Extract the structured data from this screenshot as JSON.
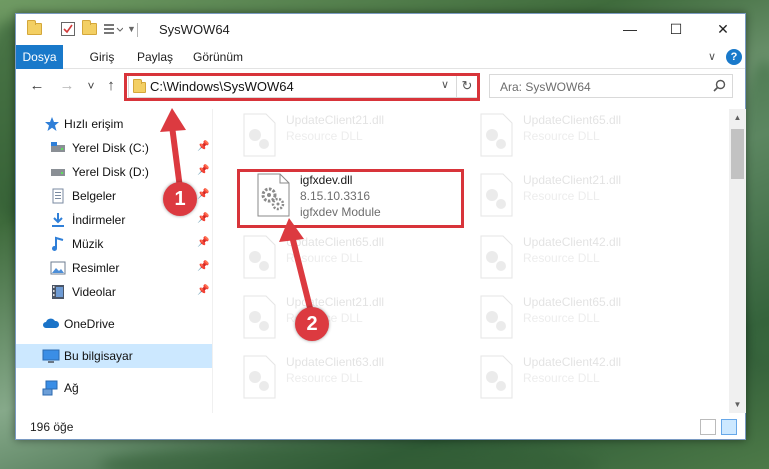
{
  "window": {
    "title": "SysWOW64",
    "minimize_glyph": "—",
    "maximize_glyph": "☐",
    "close_glyph": "✕"
  },
  "ribbon": {
    "tabs": [
      "Dosya",
      "Giriş",
      "Paylaş",
      "Görünüm"
    ],
    "expand_glyph": "∨",
    "help_glyph": "?"
  },
  "nav_buttons": {
    "back": "←",
    "forward": "→",
    "recent": "˅",
    "up": "↑"
  },
  "address": {
    "path": "C:\\Windows\\SysWOW64",
    "dropdown_glyph": "∨",
    "refresh_glyph": "↻"
  },
  "search": {
    "placeholder": "Ara: SysWOW64",
    "icon": "search-icon"
  },
  "sidebar": {
    "items": [
      {
        "label": "Hızlı erişim",
        "icon": "star-icon"
      },
      {
        "label": "Yerel Disk (C:)",
        "icon": "drive-icon",
        "pinned": true
      },
      {
        "label": "Yerel Disk (D:)",
        "icon": "drive-icon",
        "pinned": true
      },
      {
        "label": "Belgeler",
        "icon": "documents-icon",
        "pinned": true
      },
      {
        "label": "İndirmeler",
        "icon": "download-icon",
        "pinned": true
      },
      {
        "label": "Müzik",
        "icon": "music-icon",
        "pinned": true
      },
      {
        "label": "Resimler",
        "icon": "pictures-icon",
        "pinned": true
      },
      {
        "label": "Videolar",
        "icon": "videos-icon",
        "pinned": true
      },
      {
        "label": "OneDrive",
        "icon": "cloud-icon"
      },
      {
        "label": "Bu bilgisayar",
        "icon": "computer-icon",
        "selected": true
      },
      {
        "label": "Ağ",
        "icon": "network-icon"
      }
    ]
  },
  "files": {
    "highlighted": {
      "name": "igfxdev.dll",
      "version": "8.15.10.3316",
      "description": "igfxdev Module"
    },
    "background": [
      {
        "name": "UpdateClient21.dll",
        "description": "Resource DLL"
      },
      {
        "name": "UpdateClient65.dll",
        "description": "Resource DLL"
      },
      {
        "name": "UpdateClient21.dll",
        "description": "Resource DLL"
      },
      {
        "name": "UpdateClient65.dll",
        "description": "Resource DLL"
      },
      {
        "name": "UpdateClient42.dll",
        "description": "Resource DLL"
      },
      {
        "name": "UpdateClient21.dll",
        "description": "Resource DLL"
      },
      {
        "name": "UpdateClient65.dll",
        "description": "Resource DLL"
      },
      {
        "name": "UpdateClient63.dll",
        "description": "Resource DLL"
      },
      {
        "name": "UpdateClient42.dll",
        "description": "Resource DLL"
      }
    ]
  },
  "status": {
    "item_count": "196 öğe"
  },
  "annotations": {
    "step1": "1",
    "step2": "2",
    "highlight_color": "#d8343a"
  },
  "colors": {
    "accent": "#1979ca",
    "selection": "#cce8ff"
  },
  "pin_glyph": "📌"
}
